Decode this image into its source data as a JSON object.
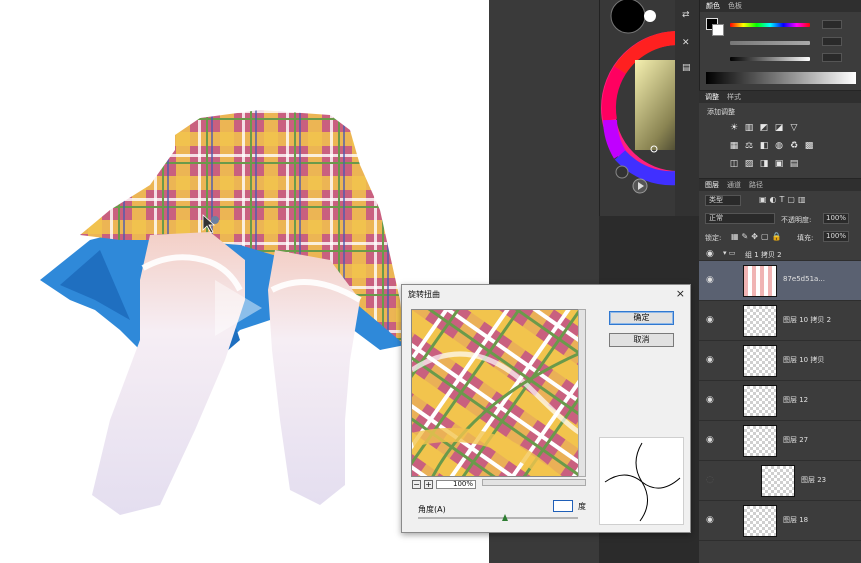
{
  "colors": {
    "canvas_bg": "#ffffff",
    "panel_bg": "#3c3c3c",
    "dialog_bg": "#f0f0f0",
    "skirt_blue": "#2f89d9",
    "plaid_pink": "#c9607f",
    "plaid_yellow": "#f2c44d"
  },
  "color_panel": {
    "tabs": [
      "颜色",
      "色板"
    ]
  },
  "adjust_panel": {
    "tabs": [
      "调整",
      "样式"
    ],
    "header": "添加调整"
  },
  "layers_panel": {
    "tabs": [
      "图层",
      "通道",
      "路径"
    ],
    "filter_label": "类型",
    "blend_mode": "正常",
    "opacity_label": "不透明度:",
    "opacity_value": "100%",
    "lock_label": "锁定:",
    "fill_label": "填充:",
    "fill_value": "100%",
    "group_name": "组 1 拷贝 2",
    "layers": [
      {
        "name": "87e5d51a...",
        "selected": true,
        "visible": true
      },
      {
        "name": "图层 10 拷贝 2",
        "selected": false,
        "visible": true
      },
      {
        "name": "图层 10 拷贝",
        "selected": false,
        "visible": true
      },
      {
        "name": "图层 12",
        "selected": false,
        "visible": true
      },
      {
        "name": "图层 27",
        "selected": false,
        "visible": true
      },
      {
        "name": "图层 23",
        "selected": false,
        "visible": false
      },
      {
        "name": "图层 18",
        "selected": false,
        "visible": true
      }
    ]
  },
  "dialog": {
    "title": "旋转扭曲",
    "ok_label": "确定",
    "cancel_label": "取消",
    "zoom_minus": "−",
    "zoom_plus": "+",
    "zoom_value": "100%",
    "angle_label": "角度(A)",
    "angle_value": "",
    "angle_unit": "度",
    "close_symbol": "×"
  }
}
